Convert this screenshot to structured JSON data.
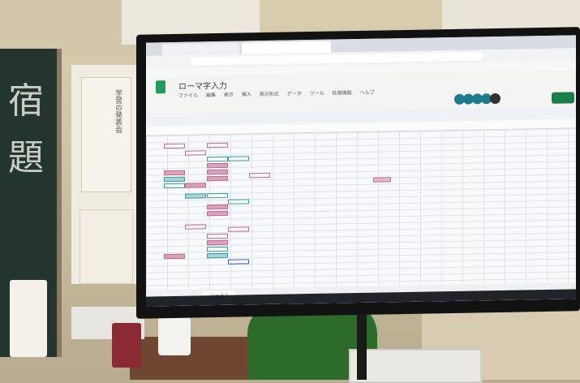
{
  "spreadsheet": {
    "doc_title": "ローマ字入力",
    "menu_items": [
      "ファイル",
      "編集",
      "表示",
      "挿入",
      "表示形式",
      "データ",
      "ツール",
      "拡張機能",
      "ヘルプ"
    ],
    "sheet_tab": "シート1"
  },
  "notice": {
    "vertical_text": "学習の発表会"
  },
  "blackboard": {
    "chalk_text": "宿題"
  },
  "colors": {
    "cell_pink": "#c06c8c",
    "cell_teal": "#3d9ca3",
    "cell_blue": "#3f5fc9",
    "sheets_green": "#1e9c58"
  }
}
